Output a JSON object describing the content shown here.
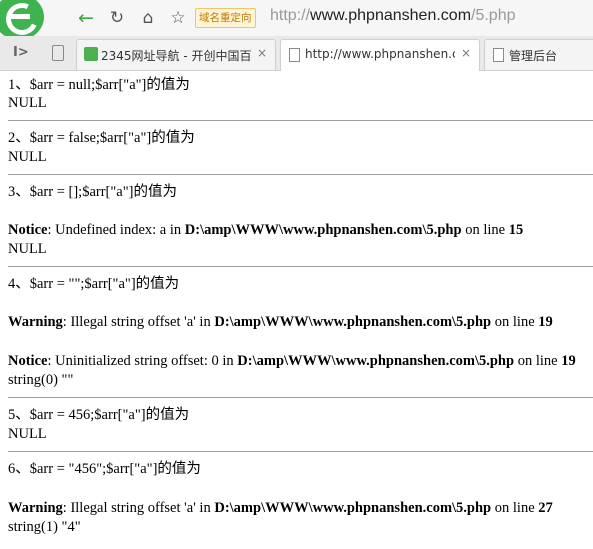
{
  "browser": {
    "redirect_tag": "域名重定向",
    "address_prefix": "http://",
    "address_host": "www.phpnanshen.com",
    "address_path": "/5.php",
    "tabs": [
      {
        "title": "2345网址导航 - 开创中国百",
        "close": "×"
      },
      {
        "title": "http://www.phpnanshen.cc",
        "close": "×"
      },
      {
        "title": "管理后台"
      }
    ]
  },
  "sections": [
    {
      "q": "1、$arr = null;$arr[\"a\"]的值为",
      "out": "NULL"
    },
    {
      "q": "2、$arr = false;$arr[\"a\"]的值为",
      "out": "NULL"
    },
    {
      "q": "3、$arr = [];$arr[\"a\"]的值为",
      "n1_label": "Notice",
      "n1_text": ": Undefined index: a in ",
      "n1_path": "D:\\amp\\WWW\\www.phpnanshen.com\\5.php",
      "n1_online": " on line ",
      "n1_line": "15",
      "out": "NULL"
    },
    {
      "q": "4、$arr = \"\";$arr[\"a\"]的值为",
      "n1_label": "Warning",
      "n1_text": ": Illegal string offset 'a' in ",
      "n1_path": "D:\\amp\\WWW\\www.phpnanshen.com\\5.php",
      "n1_online": " on line ",
      "n1_line": "19",
      "n2_label": "Notice",
      "n2_text": ": Uninitialized string offset: 0 in ",
      "n2_path": "D:\\amp\\WWW\\www.phpnanshen.com\\5.php",
      "n2_online": " on line ",
      "n2_line": "19",
      "out": "string(0) \"\""
    },
    {
      "q": "5、$arr = 456;$arr[\"a\"]的值为",
      "out": "NULL"
    },
    {
      "q": "6、$arr = \"456\";$arr[\"a\"]的值为",
      "n1_label": "Warning",
      "n1_text": ": Illegal string offset 'a' in ",
      "n1_path": "D:\\amp\\WWW\\www.phpnanshen.com\\5.php",
      "n1_online": " on line ",
      "n1_line": "27",
      "out": "string(1) \"4\""
    }
  ]
}
